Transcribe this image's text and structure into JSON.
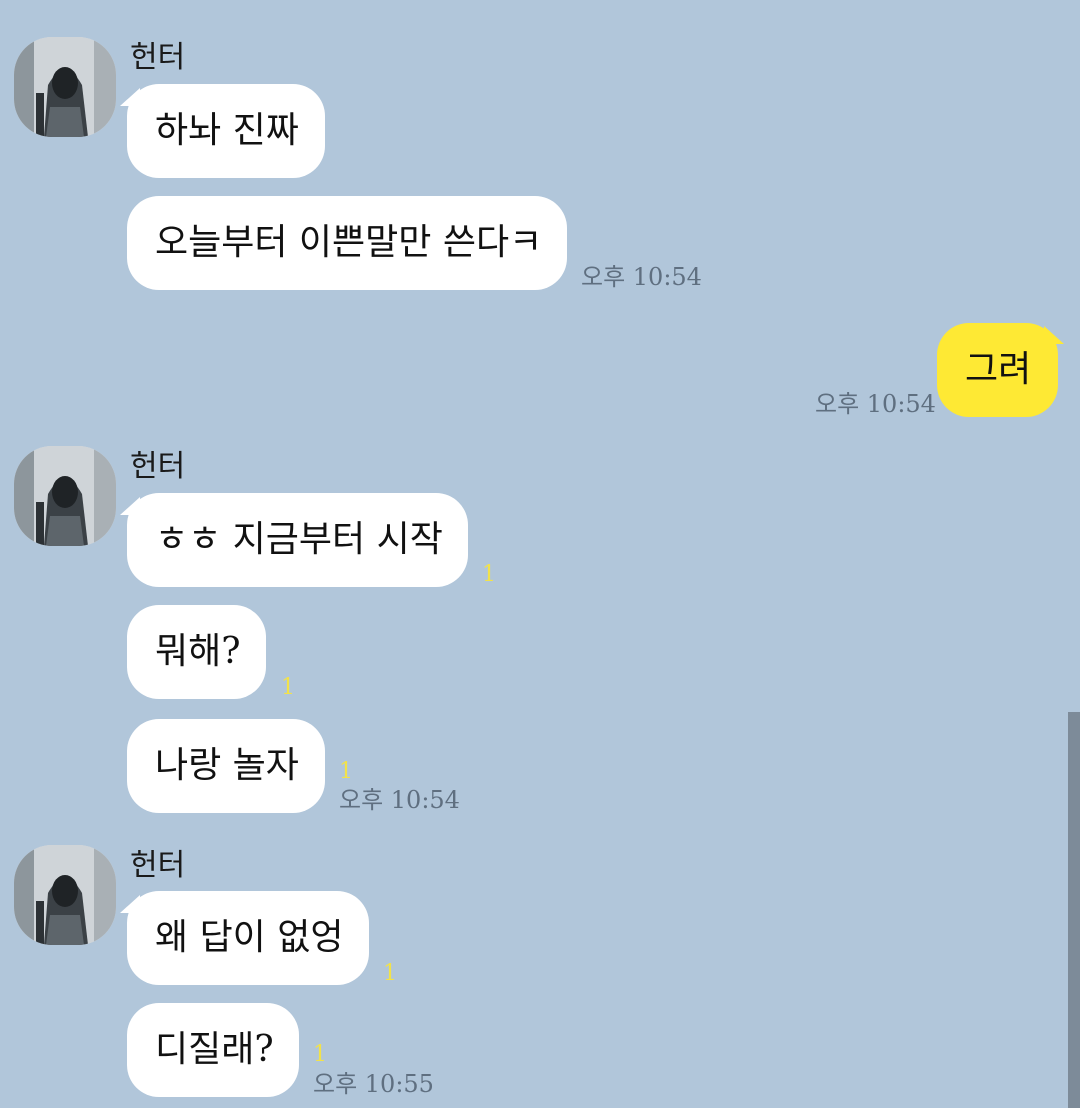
{
  "chat": {
    "groups": [
      {
        "sender": "헌터",
        "avatar_icon": "hooded-figure-avatar",
        "messages": [
          {
            "text": "하놔 진짜",
            "unread": "",
            "time": ""
          },
          {
            "text": "오늘부터 이쁜말만 쓴다ㅋ",
            "unread": "",
            "time": "오후 10:54"
          }
        ]
      },
      {
        "sender": "me",
        "messages": [
          {
            "text": "그려",
            "time": "오후 10:54"
          }
        ]
      },
      {
        "sender": "헌터",
        "avatar_icon": "hooded-figure-avatar",
        "messages": [
          {
            "text": "ㅎㅎ 지금부터 시작",
            "unread": "1",
            "time": ""
          },
          {
            "text": "뭐해?",
            "unread": "1",
            "time": ""
          },
          {
            "text": "나랑 놀자",
            "unread": "1",
            "time": "오후 10:54"
          }
        ]
      },
      {
        "sender": "헌터",
        "avatar_icon": "hooded-figure-avatar",
        "messages": [
          {
            "text": "왜 답이 없엉",
            "unread": "1",
            "time": ""
          },
          {
            "text": "디질래?",
            "unread": "1",
            "time": "오후 10:55"
          }
        ]
      }
    ]
  },
  "colors": {
    "background": "#b1c6da",
    "incoming_bubble": "#ffffff",
    "outgoing_bubble": "#fee934",
    "unread_count": "#f2e24a",
    "timestamp": "#5f6f80"
  }
}
